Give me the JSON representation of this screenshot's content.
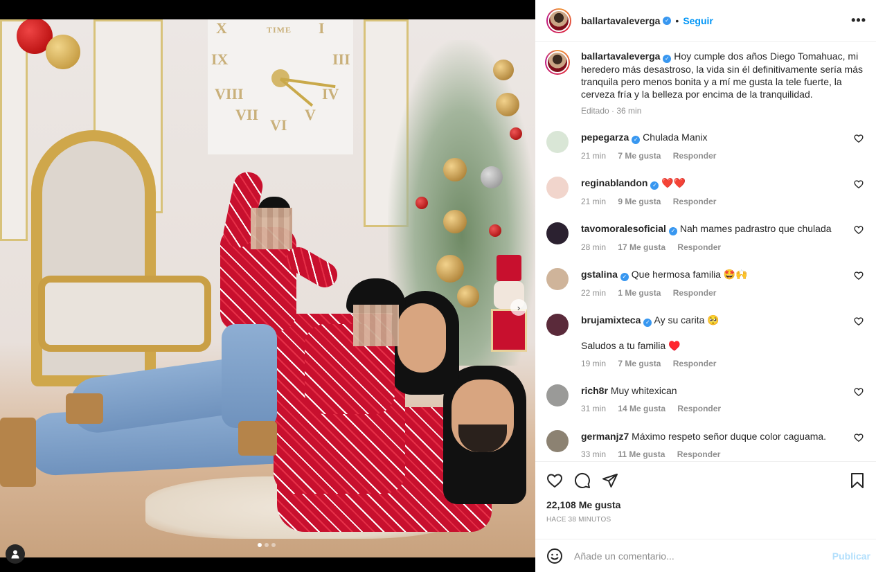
{
  "post": {
    "username": "ballartavaleverga",
    "follow_label": "Seguir",
    "more_label": "•••",
    "separator": "•",
    "caption_text": "Hoy cumple dos años Diego Tomahuac, mi heredero más desastroso, la vida sin él definitivamente sería más tranquila pero menos bonita y a mí me gusta la tele fuerte, la cerveza fría y la belleza por encima de la tranquilidad.",
    "caption_meta": "Editado · 36 min",
    "likes": "22,108 Me gusta",
    "time_ago": "HACE 38 MINUTOS",
    "image_pages": 3,
    "image_current_page": 1
  },
  "photo": {
    "clock_label": "TIME"
  },
  "comments": [
    {
      "username": "pepegarza",
      "verified": true,
      "text": "Chulada Manix",
      "time": "21 min",
      "likes": "7 Me gusta",
      "reply": "Responder",
      "avatar_color": "#d9e6d6"
    },
    {
      "username": "reginablandon",
      "verified": true,
      "text": "❤️❤️",
      "time": "21 min",
      "likes": "9 Me gusta",
      "reply": "Responder",
      "avatar_color": "#f1d5cc"
    },
    {
      "username": "tavomoralesoficial",
      "verified": true,
      "text": "Nah mames padrastro que chulada",
      "time": "28 min",
      "likes": "17 Me gusta",
      "reply": "Responder",
      "avatar_color": "#2b2130"
    },
    {
      "username": "gstalina",
      "verified": true,
      "text": "Que hermosa familia 🤩🙌",
      "time": "22 min",
      "likes": "1 Me gusta",
      "reply": "Responder",
      "avatar_color": "#cfb49a"
    },
    {
      "username": "brujamixteca",
      "verified": true,
      "text": "Ay su carita 🥺",
      "text2": "Saludos a tu familia ♥️",
      "time": "19 min",
      "likes": "7 Me gusta",
      "reply": "Responder",
      "avatar_color": "#5a2a3a"
    },
    {
      "username": "rich8r",
      "verified": false,
      "text": "Muy whitexican",
      "time": "31 min",
      "likes": "14 Me gusta",
      "reply": "Responder",
      "avatar_color": "#9a9a98"
    },
    {
      "username": "germanjz7",
      "verified": false,
      "text": "Máximo respeto señor duque color caguama.",
      "time": "33 min",
      "likes": "11 Me gusta",
      "reply": "Responder",
      "avatar_color": "#8c8272"
    }
  ],
  "add_comment": {
    "placeholder": "Añade un comentario...",
    "publish_label": "Publicar"
  },
  "icons": {
    "like": "heart-icon",
    "comment": "comment-icon",
    "share": "paper-plane-icon",
    "save": "bookmark-icon",
    "emoji": "smiley-icon",
    "tags": "user-tag-icon",
    "next": "chevron-right-icon"
  },
  "colors": {
    "link_blue": "#0095f6",
    "verified_blue": "#3897f0",
    "muted": "#8e8e8e",
    "publish_disabled": "#b2dffc"
  }
}
